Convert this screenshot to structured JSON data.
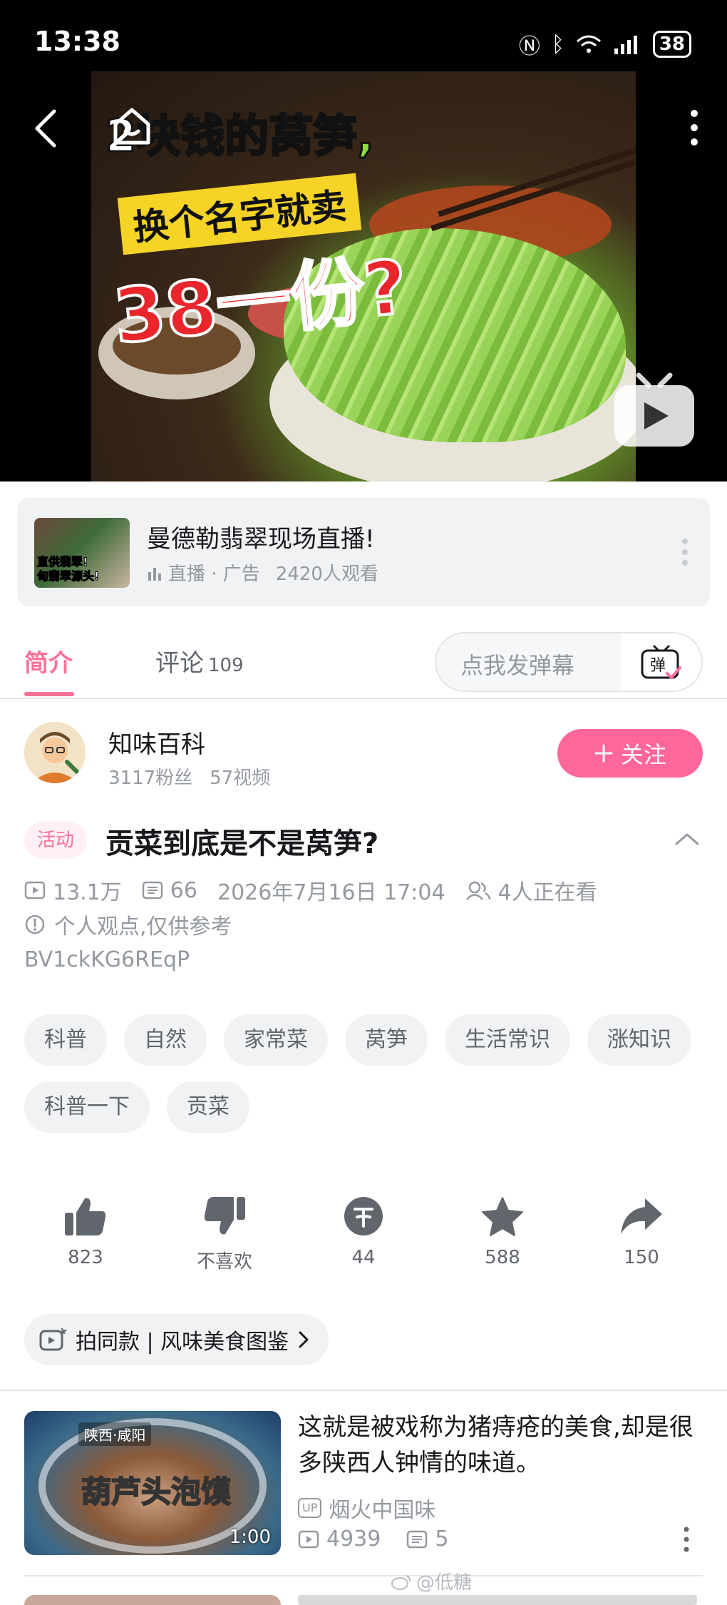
{
  "status_bar": {
    "time": "13:38",
    "battery": "38"
  },
  "video": {
    "overlay_line1_a": "2块钱的",
    "overlay_line1_b": "莴笋,",
    "overlay_line2": "换个名字就卖",
    "overlay_line3": "38一份?"
  },
  "ad": {
    "title": "曼德勒翡翠现场直播!",
    "thumb_text": "直供翡翠!\n甸翡翠源头!",
    "meta_type": "直播 · 广告",
    "meta_viewers": "2420人观看"
  },
  "tabs": {
    "intro": "简介",
    "comments": "评论",
    "comments_count": "109",
    "danmaku_placeholder": "点我发弹幕",
    "danmaku_button": "弹"
  },
  "uploader": {
    "name": "知味百科",
    "fans": "3117粉丝",
    "videos": "57视频",
    "follow_label": "关注"
  },
  "video_info": {
    "badge": "活动",
    "title": "贡菜到底是不是莴笋?",
    "views": "13.1万",
    "danmaku_count": "66",
    "date": "2026年7月16日 17:04",
    "watching": "4人正在看",
    "notice": "个人观点,仅供参考",
    "bvid": "BV1ckKG6REqP"
  },
  "tags": [
    "科普",
    "自然",
    "家常菜",
    "莴笋",
    "生活常识",
    "涨知识",
    "科普一下",
    "贡菜"
  ],
  "actions": {
    "like": "823",
    "dislike": "不喜欢",
    "coin": "44",
    "favorite": "588",
    "share": "150"
  },
  "same_style": {
    "label": "拍同款 | 风味美食图鉴"
  },
  "recommendation": {
    "title": "这就是被戏称为猪痔疮的美食,却是很多陕西人钟情的味道。",
    "thumb_location": "陕西·咸阳",
    "thumb_text": "葫芦头泡馍",
    "duration": "1:00",
    "up_badge": "UP",
    "uploader": "烟火中国味",
    "views": "4939",
    "danmaku": "5"
  },
  "watermark": "@低糖",
  "colors": {
    "accent": "#fb7299",
    "follow": "#ff6699",
    "muted": "#9499a0"
  },
  "icons": [
    "back-icon",
    "home-icon",
    "more-icon",
    "tv-play-icon",
    "bars-icon",
    "danmaku-icon",
    "plus-icon",
    "chevron-up-icon",
    "play-count-icon",
    "danmaku-count-icon",
    "watching-icon",
    "info-icon",
    "like-icon",
    "dislike-icon",
    "coin-icon",
    "star-icon",
    "share-icon",
    "camera-icon",
    "chevron-right-icon",
    "up-badge-icon"
  ]
}
